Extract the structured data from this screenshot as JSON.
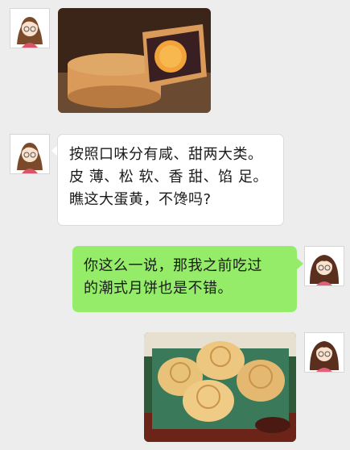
{
  "messages": [
    {
      "side": "left",
      "type": "image",
      "image_subject": "cantonese-mooncake-with-salted-egg-yolk"
    },
    {
      "side": "left",
      "type": "text",
      "lines": [
        "按照口味分有咸、甜两大类。",
        "皮 薄、松 软、香 甜、馅 足。",
        "瞧这大蛋黄，不馋吗?"
      ]
    },
    {
      "side": "right",
      "type": "text",
      "lines": [
        "你这么一说，那我之前吃过",
        "的潮式月饼也是不错。"
      ]
    },
    {
      "side": "right",
      "type": "image",
      "image_subject": "teochew-flaky-mooncakes"
    }
  ],
  "colors": {
    "background": "#ededed",
    "bubble_left": "#ffffff",
    "bubble_right": "#95ec69"
  }
}
